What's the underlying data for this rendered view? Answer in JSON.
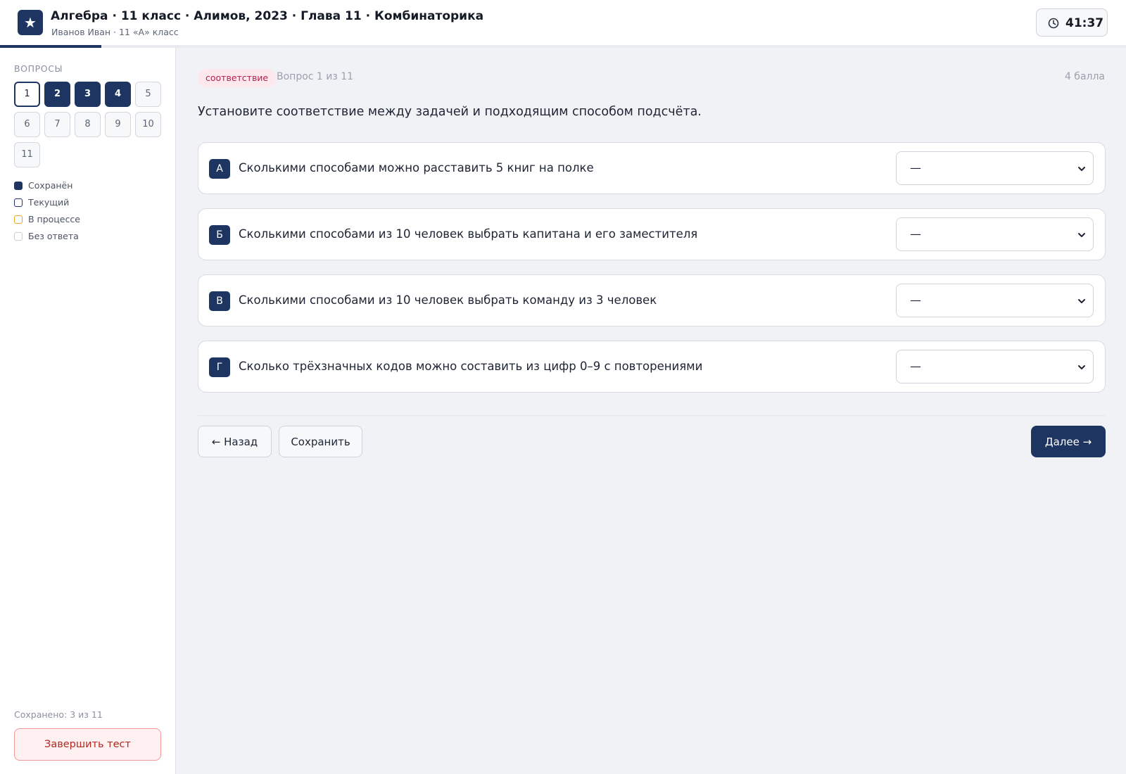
{
  "header": {
    "logo_glyph": "★",
    "title": "Алгебра · 11 класс · Алимов, 2023 · Глава 11 · Комбинаторика",
    "subtitle": "Иванов Иван · 11 «А» класс",
    "timer": "41:37",
    "timer_icon": "clock-icon",
    "progress_fraction": 0.09
  },
  "sidebar": {
    "heading": "ВОПРОСЫ",
    "questions": [
      {
        "label": "1",
        "state": "current"
      },
      {
        "label": "2",
        "state": "saved"
      },
      {
        "label": "3",
        "state": "saved"
      },
      {
        "label": "4",
        "state": "saved"
      },
      {
        "label": "5",
        "state": "unanswered"
      },
      {
        "label": "6",
        "state": "unanswered"
      },
      {
        "label": "7",
        "state": "unanswered"
      },
      {
        "label": "8",
        "state": "unanswered"
      },
      {
        "label": "9",
        "state": "unanswered"
      },
      {
        "label": "10",
        "state": "unanswered"
      },
      {
        "label": "11",
        "state": "unanswered"
      }
    ],
    "legend": [
      {
        "label": "Сохранён",
        "color": "#1f3561",
        "style": "filled"
      },
      {
        "label": "Текущий",
        "color": "#1f3561",
        "style": "outline"
      },
      {
        "label": "В процессе",
        "color": "#e0a526",
        "style": "outline"
      },
      {
        "label": "Без ответа",
        "color": "#c9cdd4",
        "style": "outline"
      }
    ],
    "saved_count": "Сохранено: 3 из 11",
    "finish_label": "Завершить тест"
  },
  "question": {
    "type_badge": "соответствие",
    "counter": "Вопрос 1 из 11",
    "points": "4 балла",
    "text": "Установите соответствие между задачей и подходящим способом подсчёта.",
    "rows": [
      {
        "letter": "А",
        "text": "Сколькими способами можно расставить 5 книг на полке",
        "selected": "—"
      },
      {
        "letter": "Б",
        "text": "Сколькими способами из 10 человек выбрать капитана и его заместителя",
        "selected": "—"
      },
      {
        "letter": "В",
        "text": "Сколькими способами из 10 человек выбрать команду из 3 человек",
        "selected": "—"
      },
      {
        "letter": "Г",
        "text": "Сколько трёхзначных кодов можно составить из цифр 0–9 с повторениями",
        "selected": "—"
      }
    ]
  },
  "nav": {
    "back_label": "← Назад",
    "save_label": "Сохранить",
    "next_label": "Далее →"
  },
  "colors": {
    "accent": "#1f3561",
    "danger": "#b3261e",
    "badge_bg": "#fde8ee",
    "badge_text": "#b5204a"
  }
}
